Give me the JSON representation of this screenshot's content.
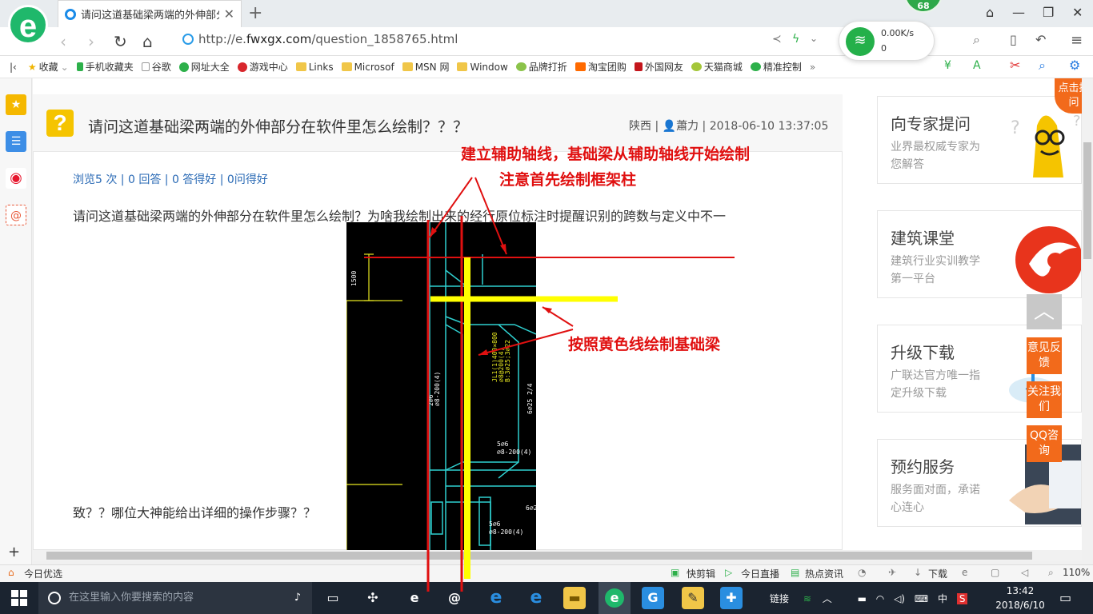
{
  "browser": {
    "tab_title": "请问这道基础梁两端的外伸部分在",
    "url_prefix": "http://e.",
    "url_domain": "fwxgx.com",
    "url_path": "/question_1858765.html",
    "badge_count": "68",
    "net_speed": "0.00K/s",
    "net_count": "0"
  },
  "bookmarks": [
    {
      "label": "收藏"
    },
    {
      "label": "手机收藏夹"
    },
    {
      "label": "谷歌"
    },
    {
      "label": "网址大全"
    },
    {
      "label": "游戏中心"
    },
    {
      "label": "Links"
    },
    {
      "label": "Microsof"
    },
    {
      "label": "MSN 网"
    },
    {
      "label": "Window"
    },
    {
      "label": "品牌打折"
    },
    {
      "label": "淘宝团购"
    },
    {
      "label": "外国网友"
    },
    {
      "label": "天猫商城"
    },
    {
      "label": "精准控制"
    }
  ],
  "question": {
    "title": "请问这道基础梁两端的外伸部分在软件里怎么绘制？？？",
    "province": "陕西",
    "author": "蕭力",
    "datetime": "2018-06-10 13:37:05",
    "stats": "浏览5 次 | 0 回答 | 0 答得好 | 0问得好",
    "body_line1": "请问这道基础梁两端的外伸部分在软件里怎么绘制？为啥我绘制出来的经行原位标注时提醒识别的跨数与定义中不一",
    "body_line2": "致？？哪位大神能给出详细的操作步骤？？",
    "image_dim_label": "1500"
  },
  "annotations": {
    "line1": "建立辅助轴线，基础梁从辅助轴线开始绘制",
    "line2": "注意首先绘制框架柱",
    "line3": "按照黄色线绘制基础梁"
  },
  "sidebar_cards": [
    {
      "title": "向专家提问",
      "sub": "业界最权威专家为您解答"
    },
    {
      "title": "建筑课堂",
      "sub": "建筑行业实训教学第一平台"
    },
    {
      "title": "升级下载",
      "sub": "广联达官方唯一指定升级下载"
    },
    {
      "title": "预约服务",
      "sub": "服务面对面，承诺心连心"
    }
  ],
  "float_buttons": {
    "feedback": "意见反馈",
    "follow": "关注我们",
    "qq": "QQ咨询",
    "tip": "点击提问"
  },
  "statusbar": {
    "left": "今日优选",
    "kuaijianji": "快剪辑",
    "live": "今日直播",
    "news": "热点资讯",
    "download": "下载",
    "zoom": "110%"
  },
  "taskbar": {
    "search_placeholder": "在这里输入你要搜索的内容",
    "link_label": "链接",
    "ime": "中",
    "time": "13:42",
    "date": "2018/6/10"
  },
  "colors": {
    "accent_green": "#1fb86b",
    "annotation_red": "#e01010",
    "highlight_yellow": "#ffff00",
    "float_orange": "#f26a1b"
  }
}
